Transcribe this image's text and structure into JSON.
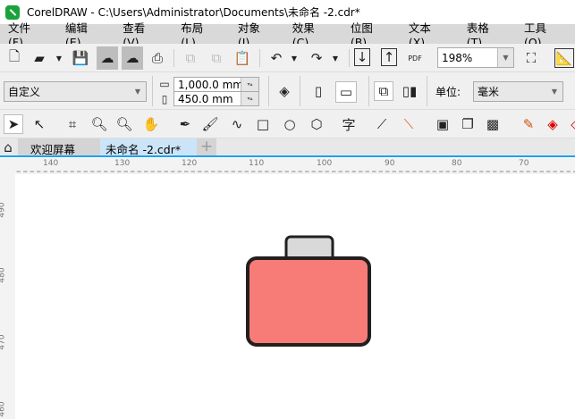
{
  "window": {
    "title": "CorelDRAW - C:\\Users\\Administrator\\Documents\\未命名 -2.cdr*"
  },
  "menu": [
    "文件(F)",
    "编辑(E)",
    "查看(V)",
    "布局(L)",
    "对象(J)",
    "效果(C)",
    "位图(B)",
    "文本(X)",
    "表格(T)",
    "工具(O)"
  ],
  "toolbar": {
    "zoom": "198%",
    "pdf_label": "PDF"
  },
  "property_bar": {
    "page_preset": "自定义",
    "width": "1,000.0 mm",
    "height": "450.0 mm",
    "units_label": "单位:",
    "units": "毫米"
  },
  "tabs": [
    "欢迎屏幕",
    "未命名 -2.cdr*"
  ],
  "ruler": {
    "h": [
      "140",
      "130",
      "120",
      "110",
      "100",
      "90",
      "80",
      "70"
    ],
    "v": [
      "490",
      "480",
      "470",
      "460"
    ]
  },
  "colors": {
    "body_fill": "#f77b77",
    "handle_fill": "#d9d9d9",
    "outline": "#231f20",
    "tab_active": "#cce4f7"
  }
}
